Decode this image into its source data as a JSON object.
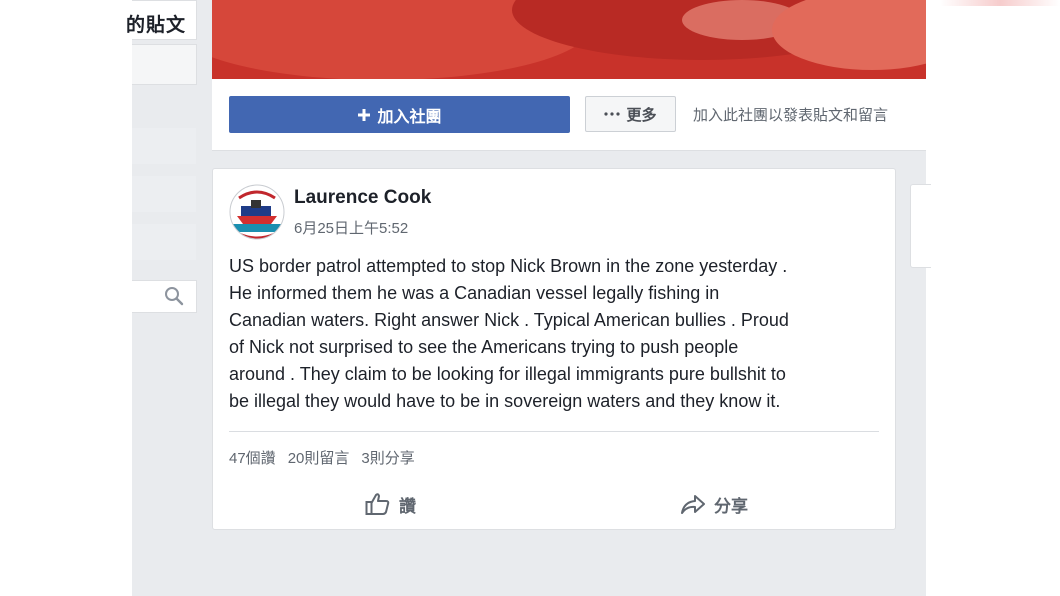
{
  "sidebar": {
    "posts_label": "的貼文"
  },
  "group": {
    "join_button": "加入社團",
    "join_icon": "plus-icon",
    "more_button": "更多",
    "more_icon": "ellipsis-icon",
    "join_hint": "加入此社團以發表貼文和留言"
  },
  "post": {
    "author": "Laurence Cook",
    "timestamp": "6月25日上午5:52",
    "body_lines": [
      "US border patrol attempted to stop Nick Brown in the zone yesterday .",
      "He informed them he was a Canadian vessel legally fishing in",
      "Canadian waters. Right answer Nick . Typical American bullies . Proud",
      "of Nick not surprised to see the Americans trying to push people",
      "around . They claim to be looking for illegal immigrants pure bullshit to",
      "be illegal they would have to be in sovereign waters and they know it."
    ],
    "stats": {
      "likes": "47個讚",
      "comments": "20則留言",
      "shares": "3則分享"
    },
    "actions": {
      "like": "讚",
      "share": "分享"
    }
  },
  "colors": {
    "primary_button": "#4267b2",
    "page_background": "#e9ebee",
    "secondary_text": "#606770"
  }
}
